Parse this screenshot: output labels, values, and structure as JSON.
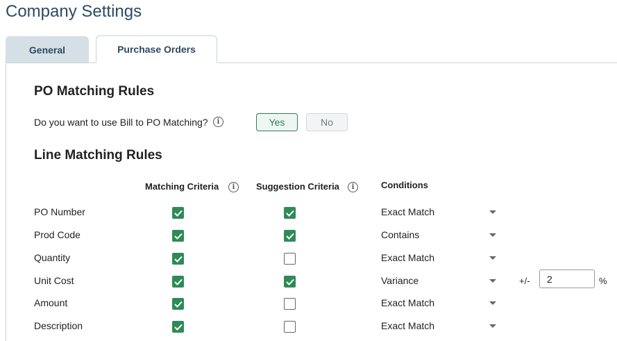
{
  "page": {
    "title": "Company Settings"
  },
  "tabs": [
    {
      "label": "General",
      "active": false
    },
    {
      "label": "Purchase Orders",
      "active": true
    }
  ],
  "po_matching": {
    "heading": "PO Matching Rules",
    "question": "Do you want to use Bill to PO Matching?",
    "yes_label": "Yes",
    "no_label": "No",
    "selected": "Yes"
  },
  "line_matching": {
    "heading": "Line Matching Rules",
    "columns": {
      "matching": "Matching Criteria",
      "suggestion": "Suggestion Criteria",
      "conditions": "Conditions"
    },
    "rows": [
      {
        "label": "PO Number",
        "matching": true,
        "suggestion": true,
        "condition": "Exact Match"
      },
      {
        "label": "Prod Code",
        "matching": true,
        "suggestion": true,
        "condition": "Contains"
      },
      {
        "label": "Quantity",
        "matching": true,
        "suggestion": false,
        "condition": "Exact Match"
      },
      {
        "label": "Unit Cost",
        "matching": true,
        "suggestion": true,
        "condition": "Variance"
      },
      {
        "label": "Amount",
        "matching": true,
        "suggestion": false,
        "condition": "Exact Match"
      },
      {
        "label": "Description",
        "matching": true,
        "suggestion": false,
        "condition": "Exact Match"
      }
    ],
    "variance": {
      "prefix": "+/-",
      "value": "2",
      "suffix": "%"
    }
  },
  "colors": {
    "accent": "#2e8b57",
    "title": "#2c4a63",
    "tab_inactive_bg": "#d5e0e6"
  },
  "icons": {
    "info": "info-icon",
    "check": "check-icon",
    "caret": "caret-down-icon"
  }
}
